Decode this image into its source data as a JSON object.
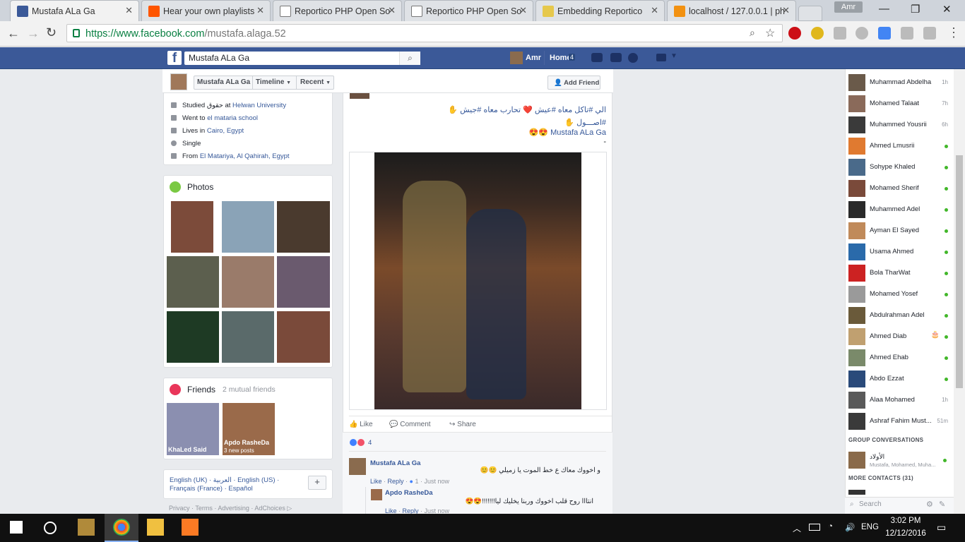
{
  "browser": {
    "tabs": [
      {
        "title": "Mustafa ALa Ga",
        "active": true,
        "favicon": "facebook-icon"
      },
      {
        "title": "Hear your own playlists",
        "favicon": "soundcloud-icon"
      },
      {
        "title": "Reportico PHP Open So",
        "favicon": "page-icon"
      },
      {
        "title": "Reportico PHP Open So",
        "favicon": "page-icon"
      },
      {
        "title": "Embedding Reportico",
        "favicon": "reportico-icon"
      },
      {
        "title": "localhost / 127.0.0.1 | ph",
        "favicon": "phpmyadmin-icon"
      }
    ],
    "profile_name": "Amr",
    "url_prefix": "https://www.facebook.com",
    "url_path": "/mustafa.alaga.52"
  },
  "fb_header": {
    "search_value": "Mustafa ALa Ga",
    "user_name": "Amr",
    "home_label": "Home",
    "home_count": "4"
  },
  "profile_nav": {
    "name_tab": "Mustafa ALa Ga",
    "timeline_tab": "Timeline",
    "recent_tab": "Recent",
    "add_friend": "Add Friend"
  },
  "intro": {
    "studied_pre": "Studied حقوق at ",
    "studied_link": "Helwan University",
    "went_pre": "Went to ",
    "went_link": "el mataria school",
    "lives_pre": "Lives in ",
    "lives_link": "Cairo, Egypt",
    "relationship": "Single",
    "from_pre": "From ",
    "from_link": "El Matariya, Al Qahirah, Egypt"
  },
  "photos": {
    "title": "Photos"
  },
  "friends": {
    "title": "Friends",
    "mutual": "2 mutual friends",
    "items": [
      {
        "name": "KhaLed Said",
        "sub": ""
      },
      {
        "name": "Apdo RasheDa",
        "sub": "3 new posts"
      }
    ]
  },
  "footer": {
    "languages_line1": "English (UK) · العربية · English (US) ·",
    "languages_line2": "Français (France) · Español",
    "plus": "+",
    "links": "Privacy · Terms · Advertising · AdChoices"
  },
  "post": {
    "line1": "الي #تاكل معاه #عيش ❤️ تحارب معاه #جيش ✋",
    "line2": "#اصـــول ✋",
    "line3": "Mustafa ALa Ga 😍😍",
    "line4": "-",
    "like": "Like",
    "comment": "Comment",
    "share": "Share",
    "reaction_count": "4"
  },
  "comments": [
    {
      "author": "Mustafa ALa Ga",
      "text": "و اخووك معاك ع خط الموت يا زميلي 😊😊",
      "meta_like": "Like",
      "meta_reply": "Reply",
      "likes": "1",
      "time": "Just now"
    },
    {
      "author": "Apdo RasheDa",
      "text": "انتااا روح قلب اخووك وربنا يخليك ليا!!!!!!!😍😍",
      "meta_like": "Like",
      "meta_reply": "Reply",
      "time": "Just now"
    }
  ],
  "chat": {
    "contacts": [
      {
        "name": "Muhammad Abdelha...",
        "status": "1h"
      },
      {
        "name": "Mohamed Talaat",
        "status": "7h"
      },
      {
        "name": "Muhammed Yousrii",
        "status": "6h"
      },
      {
        "name": "Ahmed Lmusrii",
        "status": "online"
      },
      {
        "name": "Sohype Khaled",
        "status": "online"
      },
      {
        "name": "Mohamed Sherif",
        "status": "online"
      },
      {
        "name": "Muhammed Adel",
        "status": "online"
      },
      {
        "name": "Ayman El Sayed",
        "status": "online"
      },
      {
        "name": "Usama Ahmed",
        "status": "online"
      },
      {
        "name": "Bola TharWat",
        "status": "online"
      },
      {
        "name": "Mohamed Yosef",
        "status": "online"
      },
      {
        "name": "Abdulrahman Adel",
        "status": "online"
      },
      {
        "name": "Ahmed Diab",
        "status": "birthday"
      },
      {
        "name": "Ahmed Ehab",
        "status": "online"
      },
      {
        "name": "Abdo Ezzat",
        "status": "online"
      },
      {
        "name": "Alaa Mohamed",
        "status": "1h"
      },
      {
        "name": "Ashraf Fahim Must...",
        "status": "51m"
      }
    ],
    "group_header": "GROUP CONVERSATIONS",
    "group_name": "الأولاد",
    "group_members": "Mustafa, Mohamed, Muha...",
    "more_header": "MORE CONTACTS (31)",
    "search_placeholder": "Search"
  },
  "taskbar": {
    "lang": "ENG",
    "time": "3:02 PM",
    "date": "12/12/2016"
  },
  "colors": {
    "fb_blue": "#3b5998",
    "link": "#365899",
    "online": "#42b72a"
  }
}
